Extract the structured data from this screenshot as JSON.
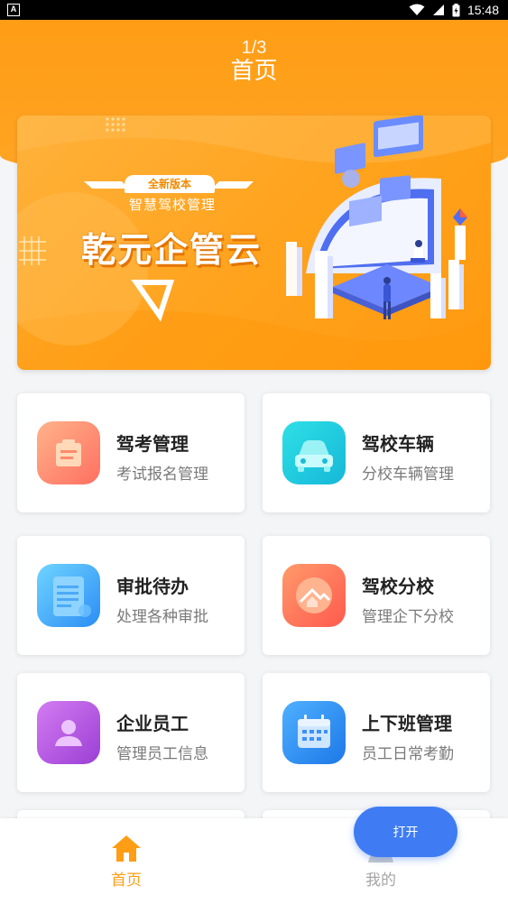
{
  "status_bar": {
    "time": "15:48"
  },
  "header": {
    "pager": "1/3",
    "title": "首页"
  },
  "banner": {
    "badge": "全新版本",
    "subtitle": "智慧驾校管理",
    "title": "乾元企管云"
  },
  "cards": [
    {
      "title": "驾考管理",
      "subtitle": "考试报名管理"
    },
    {
      "title": "驾校车辆",
      "subtitle": "分校车辆管理"
    },
    {
      "title": "审批待办",
      "subtitle": "处理各种审批"
    },
    {
      "title": "驾校分校",
      "subtitle": "管理企下分校"
    },
    {
      "title": "企业员工",
      "subtitle": "管理员工信息"
    },
    {
      "title": "上下班管理",
      "subtitle": "员工日常考勤"
    }
  ],
  "tabbar": {
    "home_label": "首页",
    "mine_label": "我的"
  },
  "open_button": {
    "label": "打开"
  },
  "colors": {
    "accent": "#ff9d15",
    "button": "#3f7cf3"
  }
}
